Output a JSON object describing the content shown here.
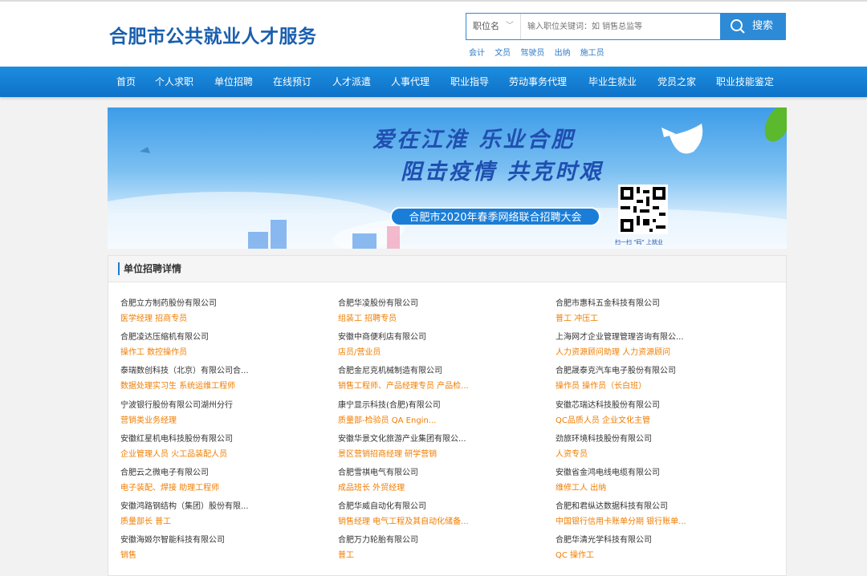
{
  "site": {
    "title": "合肥市公共就业人才服务"
  },
  "search": {
    "category": "职位名",
    "placeholder": "输入职位关键词：如 销售总监等",
    "button_label": "搜索",
    "hot_words": [
      "会计",
      "文员",
      "驾驶员",
      "出纳",
      "施工员"
    ]
  },
  "nav": [
    "首页",
    "个人求职",
    "单位招聘",
    "在线预订",
    "人才派遣",
    "人事代理",
    "职业指导",
    "劳动事务代理",
    "毕业生就业",
    "党员之家",
    "职业技能鉴定"
  ],
  "banner": {
    "line1": "爱在江淮  乐业合肥",
    "line2": "阻击疫情  共克时艰",
    "event": "合肥市2020年春季网络联合招聘大会",
    "qr_caption": "扫一扫 \"码\" 上就业"
  },
  "section": {
    "title": "单位招聘详情"
  },
  "companies": [
    {
      "name": "合肥立方制药股份有限公司",
      "jobs": "医学经理 招商专员"
    },
    {
      "name": "合肥华凌股份有限公司",
      "jobs": "组装工 招聘专员"
    },
    {
      "name": "合肥市惠科五金科技有限公司",
      "jobs": "普工 冲压工"
    },
    {
      "name": "合肥凌达压缩机有限公司",
      "jobs": "操作工 数控操作员"
    },
    {
      "name": "安徽中商便利店有限公司",
      "jobs": "店员/营业员"
    },
    {
      "name": "上海网才企业管理管理咨询有限公...",
      "jobs": "人力资源顾问助理 人力资源顾问"
    },
    {
      "name": "泰瑞数创科技（北京）有限公司合...",
      "jobs": "数据处理实习生 系统运维工程师"
    },
    {
      "name": "合肥金尼克机械制造有限公司",
      "jobs": "销售工程师、产品经理专员 产品检..."
    },
    {
      "name": "合肥晟泰克汽车电子股份有限公司",
      "jobs": "操作员 操作员（长白班）"
    },
    {
      "name": "宁波银行股份有限公司湖州分行",
      "jobs": "营销类业务经理"
    },
    {
      "name": "康宁显示科技(合肥)有限公司",
      "jobs": "质量部-检验员 QA Engin..."
    },
    {
      "name": "安徽芯瑞达科技股份有限公司",
      "jobs": "QC品质人员 企业文化主管"
    },
    {
      "name": "安徽红星机电科技股份有限公司",
      "jobs": "企业管理人员 火工品装配人员"
    },
    {
      "name": "安徽华景文化旅游产业集团有限公...",
      "jobs": "景区营销招商经理 研学营销"
    },
    {
      "name": "劲旅环境科技股份有限公司",
      "jobs": "人资专员"
    },
    {
      "name": "合肥云之微电子有限公司",
      "jobs": "电子装配、焊接 助理工程师"
    },
    {
      "name": "合肥雪祺电气有限公司",
      "jobs": "成品班长 外贸经理"
    },
    {
      "name": "安徽省金鸿电线电缆有限公司",
      "jobs": "维修工人 出纳"
    },
    {
      "name": "安徽鸿路钢结构（集团）股份有限...",
      "jobs": "质量部长 普工"
    },
    {
      "name": "合肥华威自动化有限公司",
      "jobs": "销售经理 电气工程及其自动化储备..."
    },
    {
      "name": "合肥和君纵达数据科技有限公司",
      "jobs": "中国银行信用卡账单分期 银行账单..."
    },
    {
      "name": "安徽海姬尔智能科技有限公司",
      "jobs": "销售"
    },
    {
      "name": "合肥万力轮胎有限公司",
      "jobs": "普工"
    },
    {
      "name": "合肥华清光学科技有限公司",
      "jobs": "QC 操作工"
    }
  ]
}
